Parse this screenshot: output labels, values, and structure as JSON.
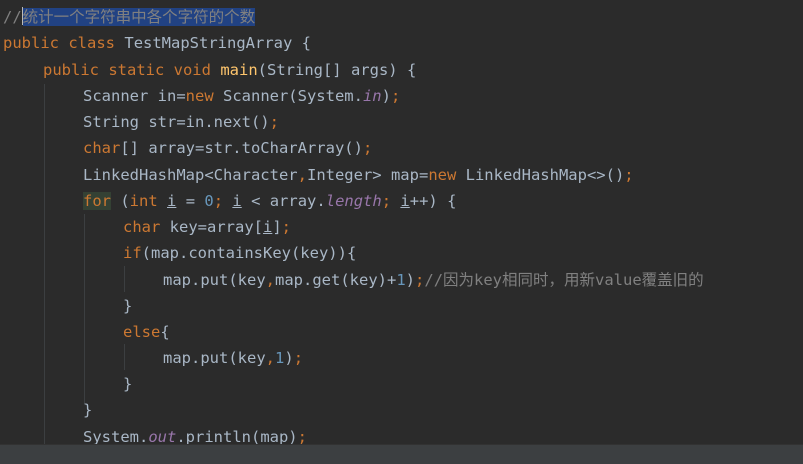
{
  "editor": {
    "language": "java",
    "colors": {
      "background": "#2b2b2b",
      "keyword": "#cc7832",
      "comment": "#808080",
      "number": "#6897bb",
      "field": "#9876aa",
      "method": "#ffc66d",
      "text": "#a9b7c6",
      "selection": "#214283"
    },
    "lines": {
      "l1_slashes": "//",
      "l1_selected": "统计一个字符串中各个字符的个数",
      "l2_public": "public",
      "l2_class": "class",
      "l2_name": "TestMapStringArray {",
      "l3_mods": "public static void",
      "l3_main": "main",
      "l3_rest": "(String[] args) {",
      "l4_a": "Scanner in=",
      "l4_new": "new",
      "l4_b": " Scanner(System.",
      "l4_in": "in",
      "l4_c": ")",
      "l4_semi": ";",
      "l5_a": "String str=in.next()",
      "l5_semi": ";",
      "l6_char": "char",
      "l6_rest": "[] array=str.toCharArray()",
      "l6_semi": ";",
      "l7_a": "LinkedHashMap<Character",
      "l7_comma": ",",
      "l7_b": "Integer> map=",
      "l7_new": "new",
      "l7_c": " LinkedHashMap<>()",
      "l7_semi": ";",
      "l8_for": "for",
      "l8_a": " (",
      "l8_int": "int",
      "l8_i1": "i",
      "l8_eq": " = ",
      "l8_zero": "0",
      "l8_semi1": ";",
      "l8_i2": "i",
      "l8_b": " < array.",
      "l8_length": "length",
      "l8_semi2": ";",
      "l8_i3": "i",
      "l8_c": "++) {",
      "l9_char": "char",
      "l9_a": " key=array[",
      "l9_i": "i",
      "l9_b": "]",
      "l9_semi": ";",
      "l10_if": "if",
      "l10_rest": "(map.containsKey(key)){",
      "l11_a": "map.put(key",
      "l11_comma": ",",
      "l11_b": "map.get(key)+",
      "l11_one": "1",
      "l11_c": ")",
      "l11_semi": ";",
      "l11_comment": "//因为key相同时，用新value覆盖旧的",
      "l12_brace": "}",
      "l13_else": "else",
      "l13_brace": "{",
      "l14_a": "map.put(key",
      "l14_comma": ",",
      "l14_one": "1",
      "l14_b": ")",
      "l14_semi": ";",
      "l15_brace": "}",
      "l16_brace": "}",
      "l17_a": "System.",
      "l17_out": "out",
      "l17_b": ".println(map)",
      "l17_semi": ";"
    }
  }
}
